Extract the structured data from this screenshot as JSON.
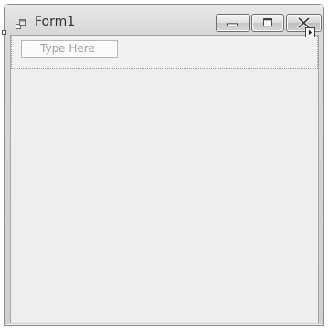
{
  "window": {
    "title": "Form1"
  },
  "menu_strip": {
    "placeholder": "Type Here"
  },
  "icons": {
    "app": "form-icon",
    "minimize": "minimize-icon",
    "maximize": "maximize-icon",
    "close": "close-icon",
    "smart_tag": "smart-tag-arrow-icon"
  }
}
